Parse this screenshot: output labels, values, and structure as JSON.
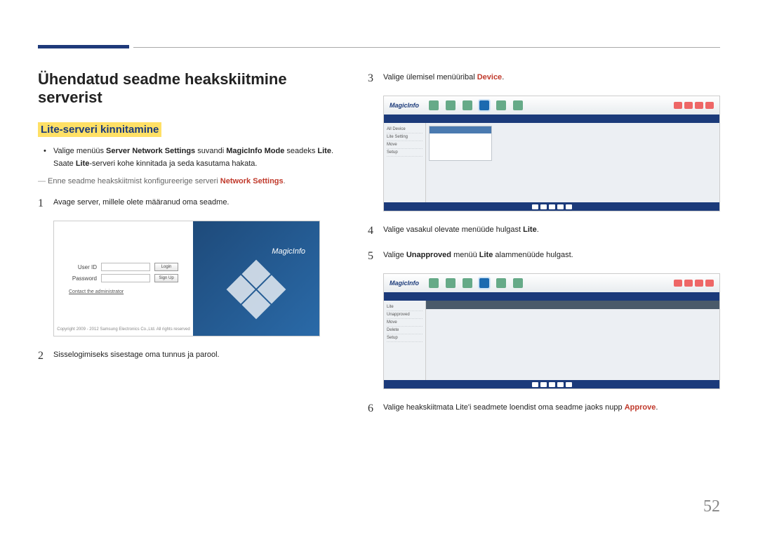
{
  "page_number": "52",
  "heading": "Ühendatud seadme heakskiitmine serverist",
  "subheading": "Lite-serveri kinnitamine",
  "bullet": {
    "part1": "Valige menüüs ",
    "bold1": "Server Network Settings",
    "part2": " suvandi ",
    "bold2": "MagicInfo Mode",
    "part3": " seadeks ",
    "bold3": "Lite",
    "part4": ".",
    "line2a": "Saate ",
    "line2b": "Lite",
    "line2c": "-serveri kohe kinnitada ja seda kasutama hakata."
  },
  "note": {
    "a": "Enne seadme heakskiitmist konfigureerige serveri ",
    "b": "Network Settings",
    "c": "."
  },
  "steps": {
    "s1": "Avage server, millele olete määranud oma seadme.",
    "s2": "Sisselogimiseks sisestage oma tunnus ja parool.",
    "s3a": "Valige ülemisel menüüribal ",
    "s3b": "Device",
    "s3c": ".",
    "s4a": "Valige vasakul olevate menüüde hulgast ",
    "s4b": "Lite",
    "s4c": ".",
    "s5a": "Valige ",
    "s5b": "Unapproved",
    "s5c": " menüü ",
    "s5d": "Lite",
    "s5e": " alammenüüde hulgast.",
    "s6a": "Valige heakskiitmata Lite'i seadmete loendist oma seadme jaoks nupp ",
    "s6b": "Approve",
    "s6c": "."
  },
  "login": {
    "user_id": "User ID",
    "password": "Password",
    "login_btn": "Login",
    "signup_btn": "Sign Up",
    "contact": "Contact the administrator",
    "copyright": "Copyright 2009 - 2012 Samsung Electronics Co.,Ltd. All rights reserved",
    "brand": "MagicInfo"
  },
  "app": {
    "brand": "MagicInfo",
    "sidebar": [
      "All Device",
      "Lite Setting",
      "Move",
      "Setup"
    ],
    "sidebar2": [
      "Lite",
      "Unapproved",
      "Move",
      "Delete",
      "Setup"
    ]
  },
  "nums": {
    "n1": "1",
    "n2": "2",
    "n3": "3",
    "n4": "4",
    "n5": "5",
    "n6": "6"
  }
}
